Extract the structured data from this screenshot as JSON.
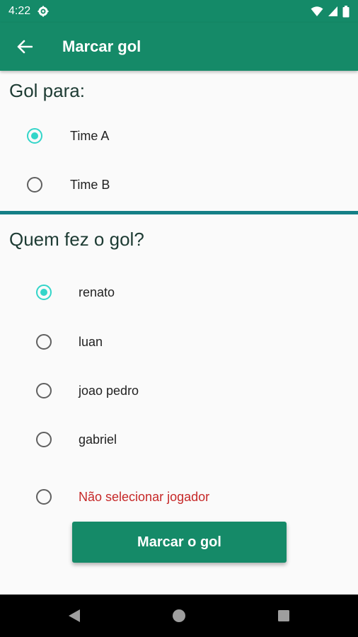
{
  "status_bar": {
    "time": "4:22",
    "icons": [
      "gear-icon",
      "wifi-icon",
      "signal-icon",
      "battery-icon"
    ]
  },
  "app_bar": {
    "title": "Marcar gol",
    "back_icon": "arrow-left-icon"
  },
  "team_section": {
    "title": "Gol para:",
    "options": [
      {
        "label": "Time A",
        "checked": true
      },
      {
        "label": "Time B",
        "checked": false
      }
    ]
  },
  "scorer_section": {
    "title": "Quem fez o gol?",
    "options": [
      {
        "label": "renato",
        "checked": true
      },
      {
        "label": "luan",
        "checked": false
      },
      {
        "label": "joao pedro",
        "checked": false
      },
      {
        "label": "gabriel",
        "checked": false
      },
      {
        "label": "Não selecionar jogador",
        "checked": false
      }
    ]
  },
  "submit_button": {
    "label": "Marcar o gol"
  },
  "nav_bar": {
    "icons": [
      "back-triangle-icon",
      "home-circle-icon",
      "recents-square-icon"
    ]
  },
  "colors": {
    "primary": "#158a68",
    "radio_accent": "#33d5c9",
    "divider": "#147f86",
    "warning_text": "#c62828"
  }
}
